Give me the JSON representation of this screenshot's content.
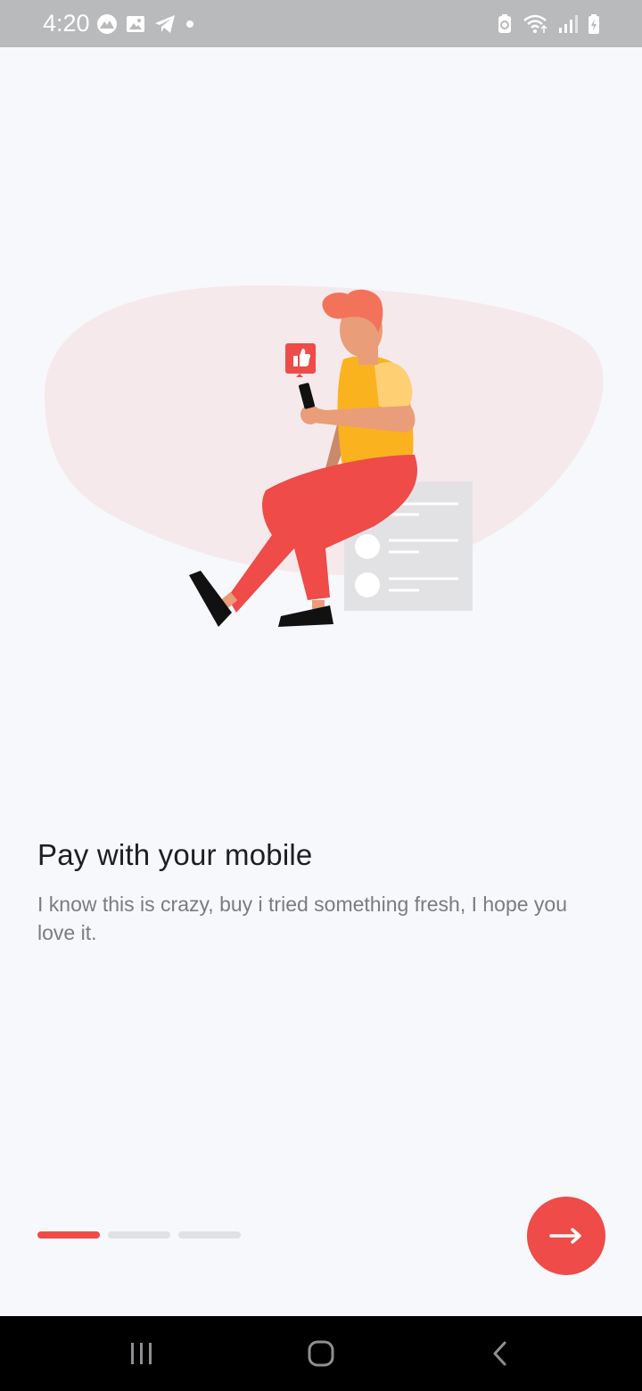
{
  "status_bar": {
    "time": "4:20",
    "left_icons": [
      "mountain-notification-icon",
      "image-notification-icon",
      "telegram-icon",
      "dot-icon"
    ],
    "right_icons": [
      "battery-saver-icon",
      "wifi-icon",
      "signal-icon",
      "battery-charging-icon"
    ]
  },
  "onboarding": {
    "title": "Pay with your mobile",
    "description": "I know this is crazy, buy i tried something fresh, I hope you love it.",
    "pages_total": 3,
    "current_page": 1
  },
  "colors": {
    "accent": "#ef4b48",
    "background": "#f7f8fc",
    "status_bar": "#b9babc",
    "title_text": "#1e1e22",
    "body_text": "#7b7b80",
    "indicator_inactive": "#e1e1e4"
  },
  "actions": {
    "next_icon": "arrow-right-icon"
  },
  "navigation_bar": {
    "buttons": [
      "recent-apps-icon",
      "home-icon",
      "back-icon"
    ]
  }
}
